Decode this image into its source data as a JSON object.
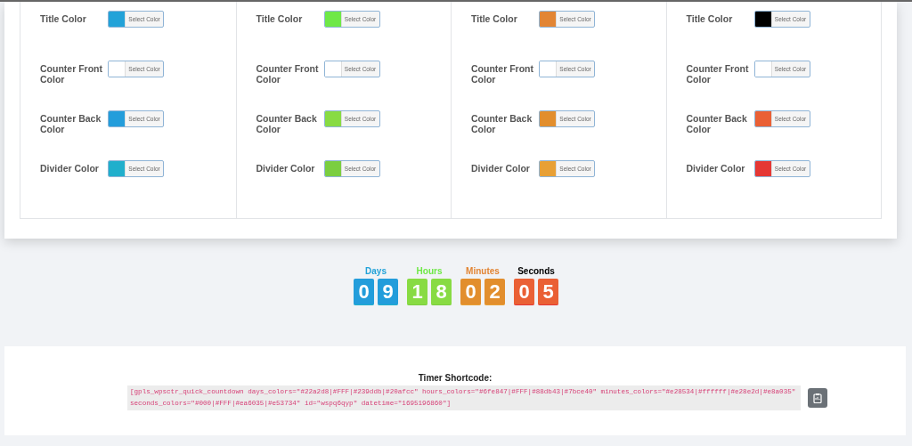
{
  "color_columns": [
    {
      "fields": [
        {
          "label": "Title Color",
          "color": "#22a2d8",
          "button": "Select Color"
        },
        {
          "label": "Counter Front Color",
          "color": "#ffffff",
          "button": "Select Color"
        },
        {
          "label": "Counter Back Color",
          "color": "#239ddb",
          "button": "Select Color"
        },
        {
          "label": "Divider Color",
          "color": "#20afcc",
          "button": "Select Color"
        }
      ]
    },
    {
      "fields": [
        {
          "label": "Title Color",
          "color": "#6fe847",
          "button": "Select Color"
        },
        {
          "label": "Counter Front Color",
          "color": "#ffffff",
          "button": "Select Color"
        },
        {
          "label": "Counter Back Color",
          "color": "#88db43",
          "button": "Select Color"
        },
        {
          "label": "Divider Color",
          "color": "#7bce40",
          "button": "Select Color"
        }
      ]
    },
    {
      "fields": [
        {
          "label": "Title Color",
          "color": "#e28534",
          "button": "Select Color"
        },
        {
          "label": "Counter Front Color",
          "color": "#ffffff",
          "button": "Select Color"
        },
        {
          "label": "Counter Back Color",
          "color": "#e28e2d",
          "button": "Select Color"
        },
        {
          "label": "Divider Color",
          "color": "#e8a035",
          "button": "Select Color"
        }
      ]
    },
    {
      "fields": [
        {
          "label": "Title Color",
          "color": "#000000",
          "button": "Select Color"
        },
        {
          "label": "Counter Front Color",
          "color": "#ffffff",
          "button": "Select Color"
        },
        {
          "label": "Counter Back Color",
          "color": "#ea6035",
          "button": "Select Color"
        },
        {
          "label": "Divider Color",
          "color": "#e53734",
          "button": "Select Color"
        }
      ]
    }
  ],
  "countdown": [
    {
      "label": "Days",
      "color": "#22a2d8",
      "digits": [
        "0",
        "9"
      ]
    },
    {
      "label": "Hours",
      "color": "#6fe847",
      "digits": [
        "1",
        "8"
      ]
    },
    {
      "label": "Minutes",
      "color": "#e28534",
      "digits": [
        "0",
        "2"
      ]
    },
    {
      "label": "Seconds",
      "color": "#000000",
      "digits": [
        "0",
        "5"
      ]
    }
  ],
  "shortcode": {
    "title": "Timer Shortcode:",
    "code": "[gpls_wpsctr_quick_countdown days_colors=\"#22a2d8|#FFF|#239ddb|#20afcc\" hours_colors=\"#6fe847|#FFF|#88db43|#7bce40\" minutes_colors=\"#e28534|#ffffff|#e28e2d|#e8a035\" seconds_colors=\"#000|#FFF|#ea6035|#e53734\" id=\"wspq6qyp\" datetime=\"1695196860\"]"
  }
}
